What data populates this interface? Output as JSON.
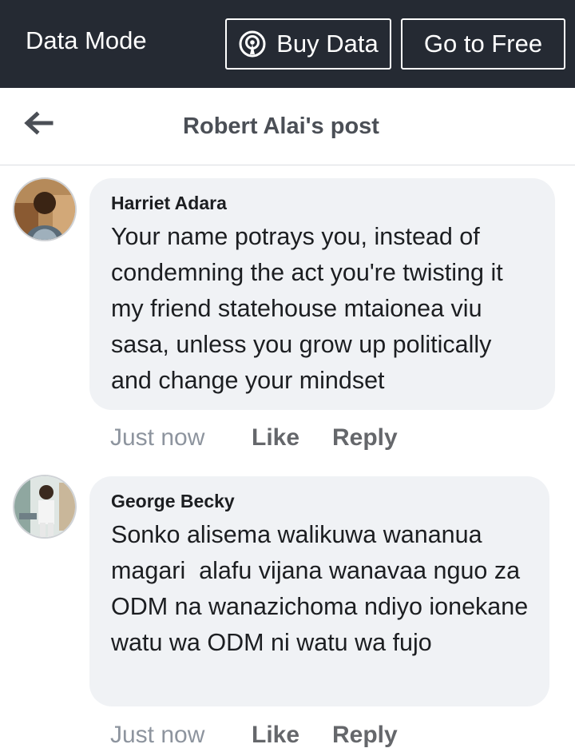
{
  "topbar": {
    "mode_label": "Data Mode",
    "buy_data_label": "Buy Data",
    "go_free_label": "Go to Free"
  },
  "header": {
    "title": "Robert Alai's post"
  },
  "comments": [
    {
      "author": "Harriet Adara",
      "text": "Your name potrays you, instead of condemning the act you're twisting it my friend statehouse mtaionea viu sasa, unless you grow up politically and change your mindset",
      "time": "Just now",
      "like": "Like",
      "reply": "Reply"
    },
    {
      "author": "George Becky",
      "text": "Sonko alisema walikuwa wananua magari  alafu vijana wanavaa nguo za ODM na wanazichoma ndiyo ionekane watu wa ODM ni watu wa fujo",
      "time": "Just now",
      "like": "Like",
      "reply": "Reply"
    }
  ],
  "icons": {
    "back": "back-arrow-icon",
    "buy_data": "broadcast-icon"
  },
  "colors": {
    "topbar_bg": "#252a33",
    "bubble_bg": "#f0f2f5",
    "title_text": "#4b4f56"
  }
}
